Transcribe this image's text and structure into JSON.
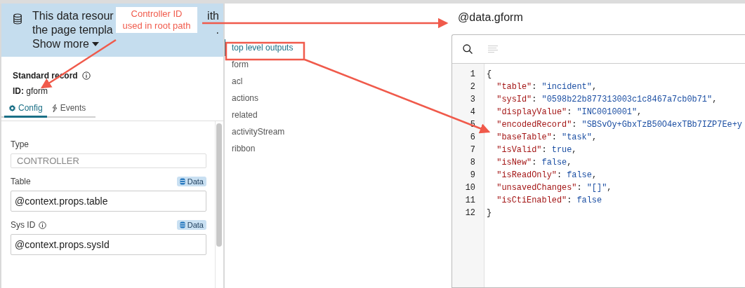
{
  "banner": {
    "lines": [
      [
        "This data resour",
        "ith"
      ],
      [
        "the page templa",
        "."
      ]
    ],
    "show_more": "Show more"
  },
  "record": {
    "title": "Standard record",
    "id": "**ID:** gform"
  },
  "tabs": [
    {
      "label": "Config",
      "selected": true
    },
    {
      "label": "Events",
      "selected": false
    }
  ],
  "fields": [
    {
      "kind": "readonly",
      "label": "Type",
      "info": false,
      "disabled": true,
      "value": "CONTROLLER"
    },
    {
      "kind": "input",
      "label": "Table",
      "info": false,
      "disabled": false,
      "badge": "Data",
      "value": "@context.props.table"
    },
    {
      "kind": "input",
      "label": "Sys ID",
      "info": true,
      "disabled": false,
      "badge": "Data",
      "value": "@context.props.sysId"
    }
  ],
  "outputs": [
    {
      "label": "top level outputs",
      "selected": true
    },
    {
      "label": "form",
      "selected": false
    },
    {
      "label": "acl",
      "selected": false
    },
    {
      "label": "actions",
      "selected": false
    },
    {
      "label": "related",
      "selected": false
    },
    {
      "label": "activityStream",
      "selected": false
    },
    {
      "label": "ribbon",
      "selected": false
    }
  ],
  "output_title": "@data.gform",
  "code_lines": [
    {
      "number": "1",
      "tokens": [
        {
          "kind": "punct",
          "text": "{"
        }
      ]
    },
    {
      "number": "2",
      "tokens": [
        {
          "kind": "key",
          "text": "  \"table\""
        },
        {
          "kind": "punct",
          "text": ": "
        },
        {
          "kind": "string",
          "text": "\"incident\""
        },
        {
          "kind": "punct",
          "text": ","
        }
      ]
    },
    {
      "number": "3",
      "tokens": [
        {
          "kind": "key",
          "text": "  \"sysId\""
        },
        {
          "kind": "punct",
          "text": ": "
        },
        {
          "kind": "string",
          "text": "\"0598b22b877313003c1c8467a7cb0b71\""
        },
        {
          "kind": "punct",
          "text": ","
        }
      ]
    },
    {
      "number": "4",
      "tokens": [
        {
          "kind": "key",
          "text": "  \"displayValue\""
        },
        {
          "kind": "punct",
          "text": ": "
        },
        {
          "kind": "string",
          "text": "\"INC0010001\""
        },
        {
          "kind": "punct",
          "text": ","
        }
      ]
    },
    {
      "number": "5",
      "tokens": [
        {
          "kind": "key",
          "text": "  \"encodedRecord\""
        },
        {
          "kind": "punct",
          "text": ": "
        },
        {
          "kind": "string",
          "text": "\"SBSvOy+GbxTzB50O4exTBb7IZP7Ee+y"
        }
      ]
    },
    {
      "number": "6",
      "tokens": [
        {
          "kind": "key",
          "text": "  \"baseTable\""
        },
        {
          "kind": "punct",
          "text": ": "
        },
        {
          "kind": "string",
          "text": "\"task\""
        },
        {
          "kind": "punct",
          "text": ","
        }
      ]
    },
    {
      "number": "7",
      "tokens": [
        {
          "kind": "key",
          "text": "  \"isValid\""
        },
        {
          "kind": "punct",
          "text": ": "
        },
        {
          "kind": "literal",
          "text": "true"
        },
        {
          "kind": "punct",
          "text": ","
        }
      ]
    },
    {
      "number": "8",
      "tokens": [
        {
          "kind": "key",
          "text": "  \"isNew\""
        },
        {
          "kind": "punct",
          "text": ": "
        },
        {
          "kind": "literal",
          "text": "false"
        },
        {
          "kind": "punct",
          "text": ","
        }
      ]
    },
    {
      "number": "9",
      "tokens": [
        {
          "kind": "key",
          "text": "  \"isReadOnly\""
        },
        {
          "kind": "punct",
          "text": ": "
        },
        {
          "kind": "literal",
          "text": "false"
        },
        {
          "kind": "punct",
          "text": ","
        }
      ]
    },
    {
      "number": "10",
      "tokens": [
        {
          "kind": "key",
          "text": "  \"unsavedChanges\""
        },
        {
          "kind": "punct",
          "text": ": "
        },
        {
          "kind": "string",
          "text": "\"[]\""
        },
        {
          "kind": "punct",
          "text": ","
        }
      ]
    },
    {
      "number": "11",
      "tokens": [
        {
          "kind": "key",
          "text": "  \"isCtiEnabled\""
        },
        {
          "kind": "punct",
          "text": ": "
        },
        {
          "kind": "literal",
          "text": "false"
        }
      ]
    },
    {
      "number": "12",
      "tokens": [
        {
          "kind": "punct",
          "text": "}"
        }
      ]
    }
  ],
  "annotation": {
    "callout": "Controller ID\nused in root path"
  }
}
